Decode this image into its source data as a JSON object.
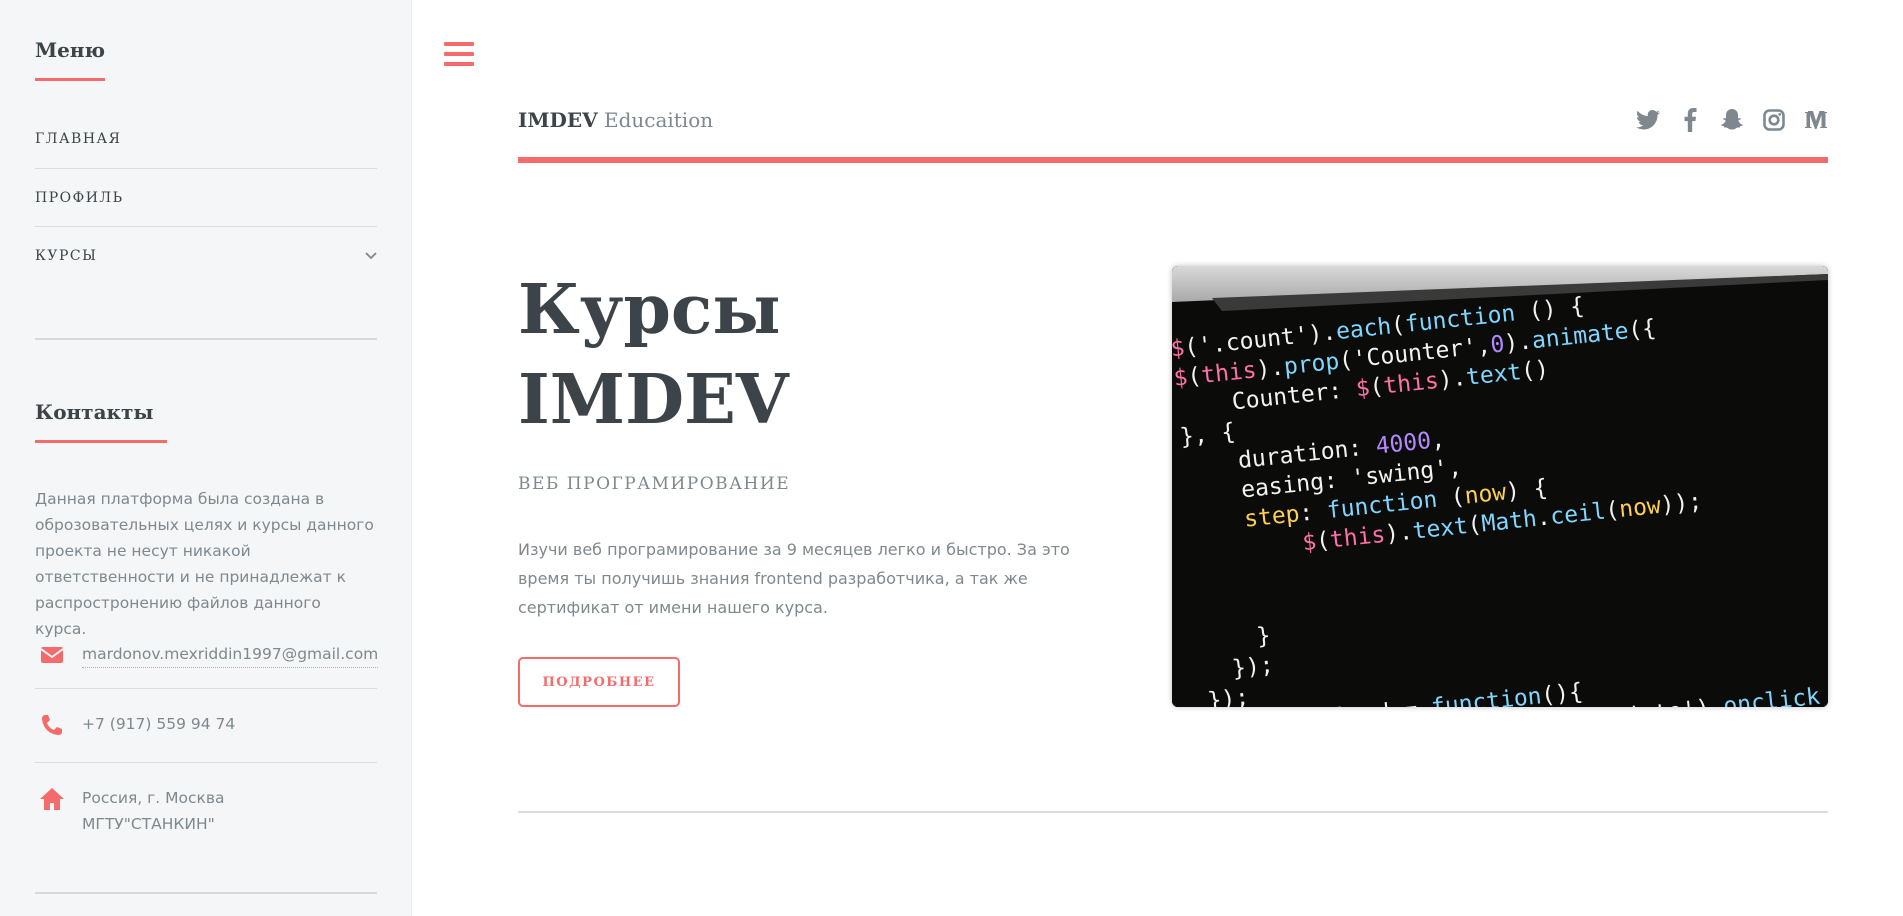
{
  "sidebar": {
    "menu_title": "Меню",
    "menu_items": [
      {
        "label": "ГЛАВНАЯ"
      },
      {
        "label": "ПРОФИЛЬ"
      },
      {
        "label": "КУРСЫ"
      }
    ],
    "contacts_title": "Контакты",
    "about": "Данная платформа была создана в оброзовательных целях и курсы данного проекта не несут никакой ответственности и не принадлежат к распростронению файлов данного курса.",
    "email": "mardonov.mexriddin1997@gmail.com",
    "phone": "+7 (917) 559 94 74",
    "address_line1": "Россия, г. Москва",
    "address_line2": "МГТУ\"СТАНКИН\""
  },
  "header": {
    "logo_bold": "IMDEV",
    "logo_light": "Educaition",
    "socials": [
      "twitter-icon",
      "facebook-icon",
      "snapchat-icon",
      "instagram-icon",
      "medium-icon"
    ]
  },
  "hero": {
    "title_line1": "Курсы",
    "title_line2": "IMDEV",
    "subtitle": "ВЕБ ПРОГРАМИРОВАНИЕ",
    "text": "Изучи веб програмирование за 9 месяцев легко и быстро. За это время ты получишь знания frontend разработчика, а так же сертификат от имени нашего курса.",
    "button": "ПОДРОБНЕЕ"
  },
  "code_image": {
    "lines": [
      "$('.count').each(function () {",
      "$(this).prop('Counter',0).animate({",
      "    Counter: $(this).text()",
      "}, {",
      "    duration: 4000,",
      "    easing: 'swing',",
      "    step: function (now) {",
      "        $(this).text(Math.ceil(now));",
      "",
      "",
      "    }",
      "  });",
      "});",
      "window.onload = function(){",
      "   document.getElementById('objeto').onclick = function(){"
    ]
  },
  "colors": {
    "accent": "#f56a6a",
    "text_dark": "#3d4449",
    "text_muted": "#7f888f",
    "sidebar_bg": "#f5f6f7"
  }
}
